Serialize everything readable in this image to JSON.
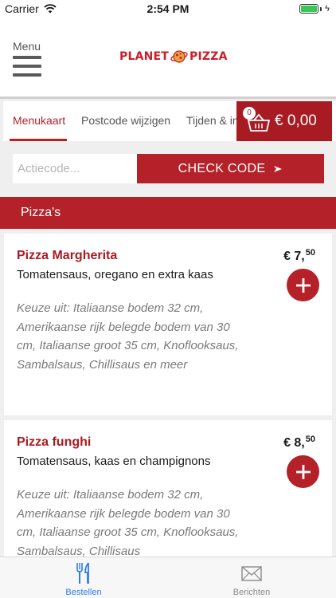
{
  "status_bar": {
    "carrier": "Carrier",
    "time": "2:54 PM"
  },
  "header": {
    "menu_label": "Menu",
    "logo_left": "PLANET",
    "logo_right": "PIZZA"
  },
  "tabs": [
    {
      "label": "Menukaart",
      "active": true
    },
    {
      "label": "Postcode wijzigen",
      "active": false
    },
    {
      "label": "Tijden & in",
      "active": false
    }
  ],
  "cart": {
    "count": "0",
    "amount": "€ 0,00"
  },
  "promo": {
    "placeholder": "Actiecode...",
    "button_label": "CHECK CODE"
  },
  "category": {
    "title": "Pizza's"
  },
  "products": [
    {
      "name": "Pizza Margherita",
      "description": "Tomatensaus, oregano en extra kaas",
      "price_main": "€ 7,",
      "price_cents": "50",
      "options": "Keuze uit: Italiaanse bodem 32 cm, Amerikaanse rijk belegde bodem van 30 cm, Italiaanse groot 35 cm, Knoflooksaus, Sambalsaus, Chillisaus en meer"
    },
    {
      "name": "Pizza funghi",
      "description": "Tomatensaus, kaas en champignons",
      "price_main": "€ 8,",
      "price_cents": "50",
      "options": "Keuze uit: Italiaanse bodem 32 cm, Amerikaanse rijk belegde bodem van 30 cm, Italiaanse groot 35 cm, Knoflooksaus, Sambalsaus, Chillisaus"
    }
  ],
  "bottom_nav": [
    {
      "label": "Bestellen",
      "icon": "fork-knife-icon",
      "active": true
    },
    {
      "label": "Berichten",
      "icon": "envelope-icon",
      "active": false
    }
  ],
  "colors": {
    "brand_red": "#b52129",
    "cart_red": "#a91b22",
    "active_blue": "#2d7ee8"
  }
}
